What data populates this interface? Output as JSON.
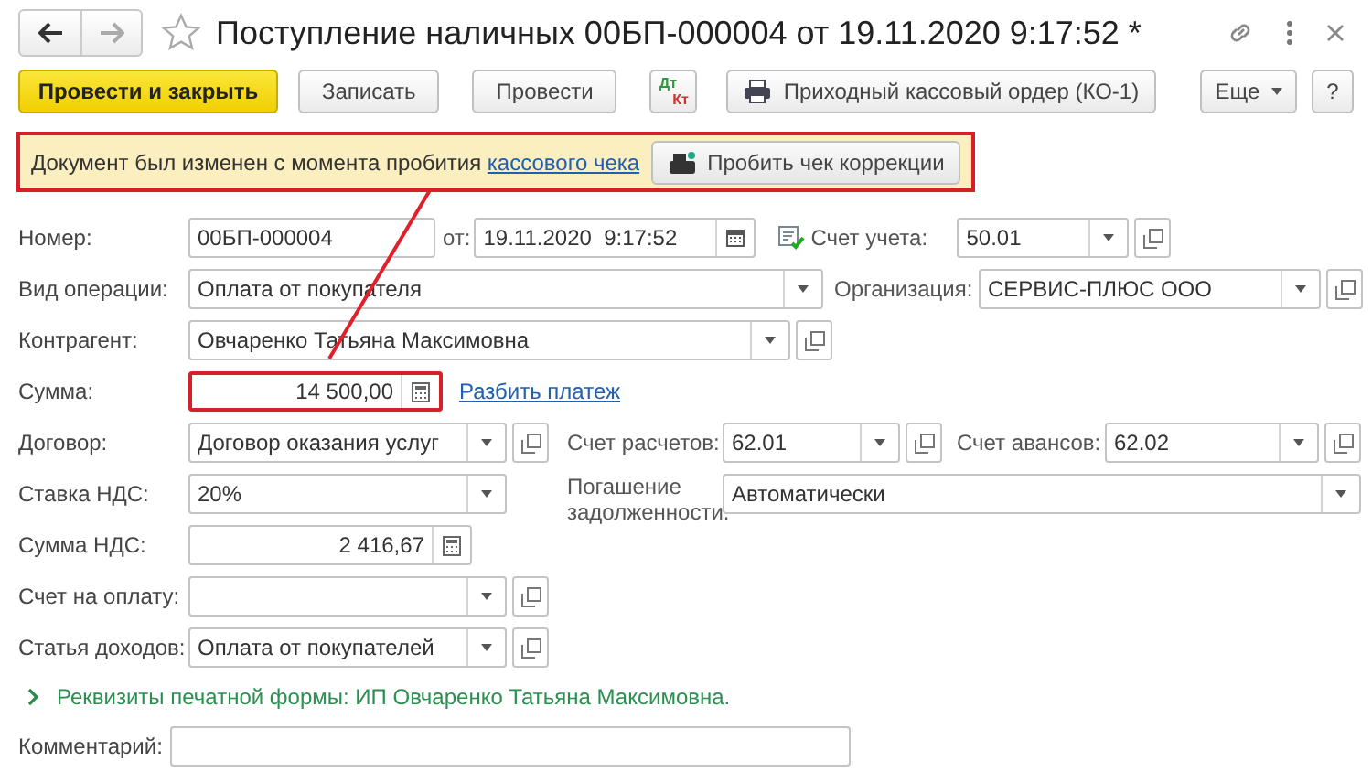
{
  "window": {
    "title": "Поступление наличных 00БП-000004 от 19.11.2020 9:17:52 *",
    "starred": false
  },
  "toolbar": {
    "buttons": [
      {
        "kind": "primary",
        "label": "Провести и закрыть"
      },
      {
        "kind": "plain",
        "label": "Записать"
      },
      {
        "kind": "plain",
        "label": "Провести"
      },
      {
        "kind": "dtkt",
        "debit": "Дт",
        "credit": "Кт"
      },
      {
        "kind": "print",
        "label": "Приходный кассовый ордер (КО-1)"
      },
      {
        "kind": "menu",
        "label": "Еще"
      },
      {
        "kind": "help",
        "label": "?"
      }
    ]
  },
  "notice": {
    "text": "Документ был изменен с момента пробития",
    "link": "кассового чека",
    "button": "Пробить чек коррекции",
    "highlighted": true
  },
  "form": {
    "rows": [
      {
        "label": "Номер:",
        "items": [
          {
            "kind": "text",
            "value": "00БП-000004"
          },
          {
            "kind": "caption",
            "text": "от:"
          },
          {
            "kind": "date",
            "value": "19.11.2020  9:17:52"
          },
          {
            "kind": "caption",
            "text": "Счет учета:"
          },
          {
            "kind": "select",
            "value": "50.01",
            "open": true
          }
        ]
      },
      {
        "label": "Вид операции:",
        "items": [
          {
            "kind": "select",
            "value": "Оплата от покупателя",
            "open": false
          },
          {
            "kind": "caption",
            "text": "Организация:"
          },
          {
            "kind": "select",
            "value": "СЕРВИС-ПЛЮС ООО",
            "open": true
          }
        ]
      },
      {
        "label": "Контрагент:",
        "items": [
          {
            "kind": "select",
            "value": "Овчаренко Татьяна Максимовна",
            "open": true
          }
        ]
      },
      {
        "label": "Сумма:",
        "items": [
          {
            "kind": "number",
            "value": "14 500,00",
            "highlighted": true
          },
          {
            "kind": "link",
            "text": "Разбить платеж"
          }
        ]
      },
      {
        "label": "Договор:",
        "items": [
          {
            "kind": "select",
            "value": "Договор оказания услуг",
            "open": true
          },
          {
            "kind": "caption",
            "text": "Счет расчетов:"
          },
          {
            "kind": "select",
            "value": "62.01",
            "open": true
          },
          {
            "kind": "caption",
            "text": "Счет авансов:"
          },
          {
            "kind": "select",
            "value": "62.02",
            "open": true
          }
        ]
      },
      {
        "label": "Ставка НДС:",
        "items": [
          {
            "kind": "select",
            "value": "20%",
            "open": false
          },
          {
            "kind": "caption",
            "text": "Погашение задолженности:"
          },
          {
            "kind": "select",
            "value": "Автоматически",
            "open": false
          }
        ]
      },
      {
        "label": "Сумма НДС:",
        "items": [
          {
            "kind": "number",
            "value": "2 416,67",
            "highlighted": false
          }
        ]
      },
      {
        "label": "Счет на оплату:",
        "items": [
          {
            "kind": "select",
            "open": true
          }
        ]
      },
      {
        "label": "Статья доходов:",
        "items": [
          {
            "kind": "select",
            "value": "Оплата от покупателей",
            "open": true
          }
        ]
      }
    ]
  },
  "print_details": {
    "text": "Реквизиты печатной формы: ИП Овчаренко Татьяна Максимовна.",
    "expanded": false
  },
  "comment": {
    "label": "Комментарий:"
  }
}
